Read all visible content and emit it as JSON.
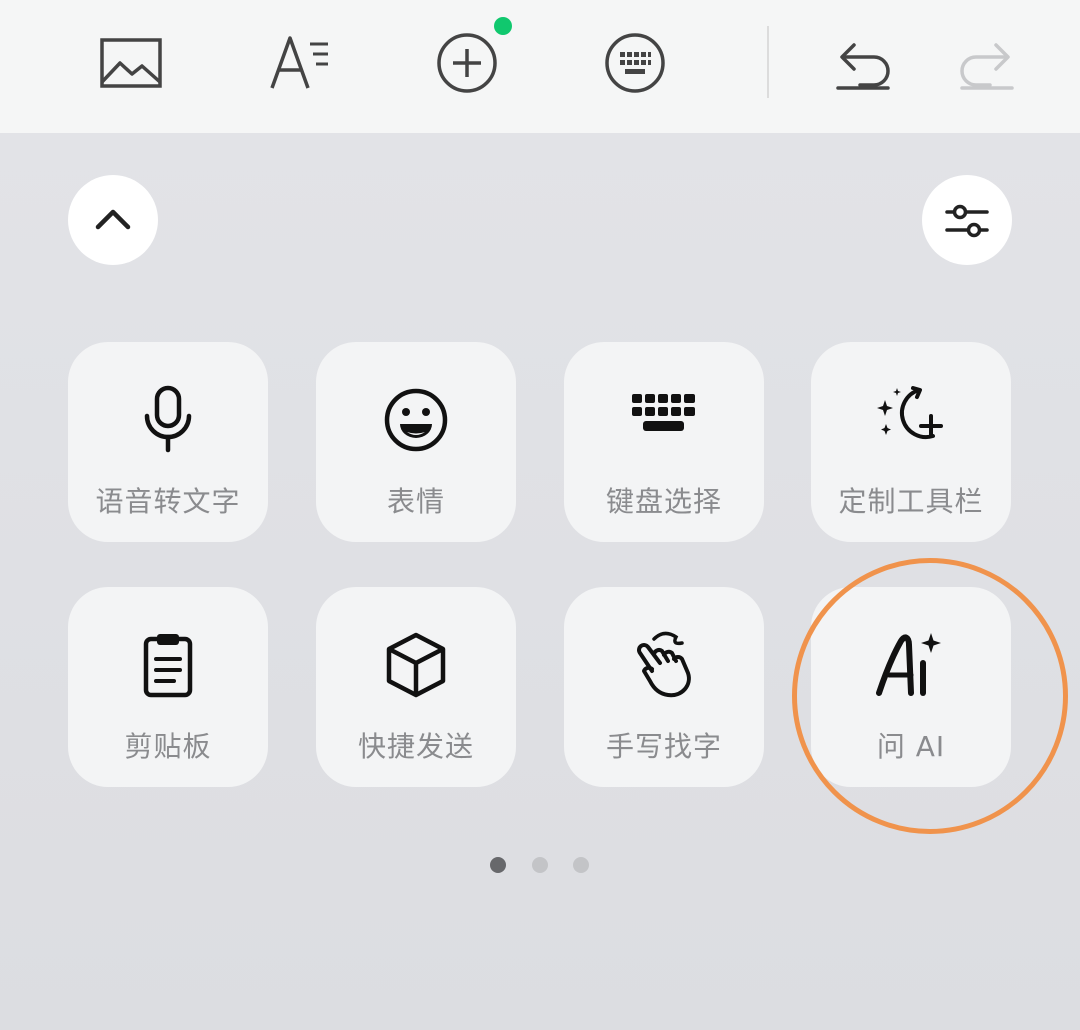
{
  "colors": {
    "icon": "#444444",
    "icon_disabled": "#c8c9cb",
    "notification_dot": "#10c86e",
    "highlight_ring": "#f0934c",
    "pager_active": "#67686b",
    "pager_inactive": "#c3c4c7"
  },
  "toolbar": {
    "buttons": [
      {
        "icon": "image-icon"
      },
      {
        "icon": "font-style-icon"
      },
      {
        "icon": "plus-circle-icon"
      },
      {
        "icon": "keyboard-circle-icon"
      },
      {
        "icon": "undo-icon"
      },
      {
        "icon": "redo-icon",
        "disabled": true
      }
    ]
  },
  "panel": {
    "collapse_icon": "chevron-up-icon",
    "settings_icon": "sliders-icon",
    "tiles": [
      {
        "label": "语音转文字",
        "icon": "microphone-icon"
      },
      {
        "label": "表情",
        "icon": "smiley-icon"
      },
      {
        "label": "键盘选择",
        "icon": "keyboard-icon"
      },
      {
        "label": "定制工具栏",
        "icon": "custom-toolbar-icon"
      },
      {
        "label": "剪贴板",
        "icon": "clipboard-icon"
      },
      {
        "label": "快捷发送",
        "icon": "cube-icon"
      },
      {
        "label": "手写找字",
        "icon": "hand-writing-icon"
      },
      {
        "label": "问 AI",
        "icon": "ai-sparkle-icon",
        "highlighted": true
      }
    ],
    "pager": {
      "pages": 3,
      "current": 1
    }
  }
}
